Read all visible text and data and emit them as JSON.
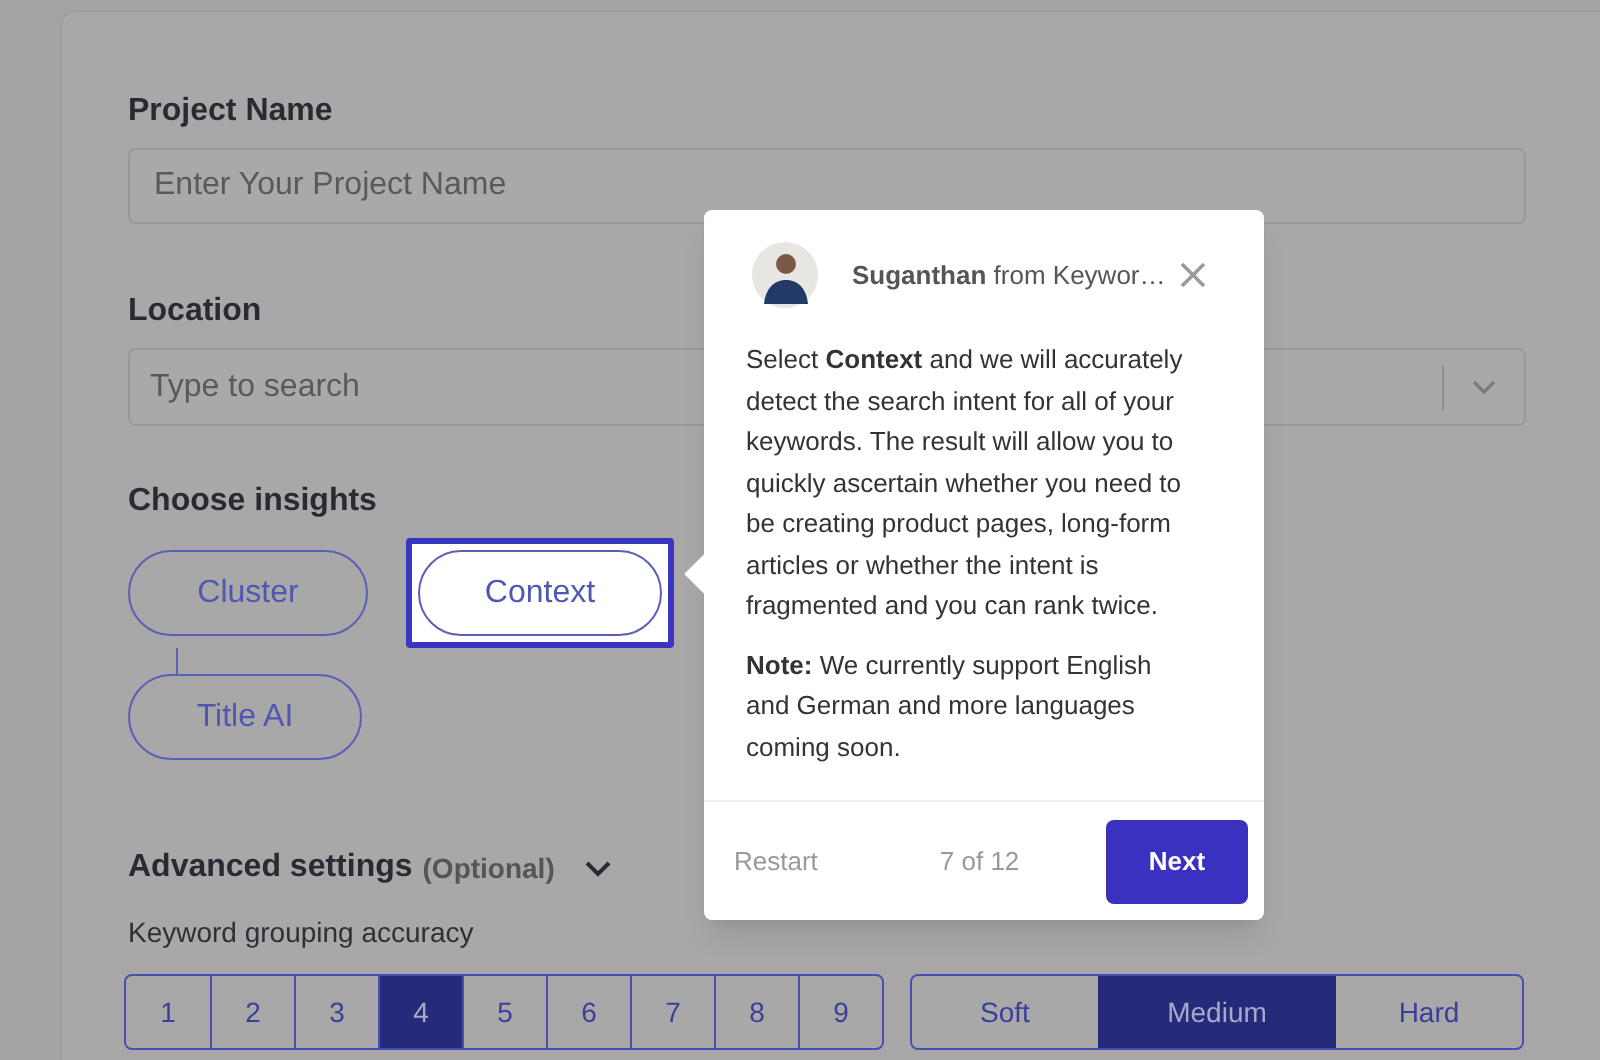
{
  "form": {
    "project_name": {
      "label": "Project Name",
      "placeholder": "Enter Your Project Name"
    },
    "location": {
      "label": "Location",
      "placeholder": "Type to search"
    },
    "insights": {
      "label": "Choose insights",
      "options": [
        {
          "label": "Cluster",
          "selected": false
        },
        {
          "label": "Context",
          "selected": true
        },
        {
          "label": "Title AI",
          "selected": false
        }
      ]
    },
    "advanced": {
      "title": "Advanced settings",
      "note": "(Optional)",
      "expanded": true,
      "accuracy": {
        "label": "Keyword grouping accuracy",
        "options": [
          {
            "label": "1",
            "selected": false
          },
          {
            "label": "2",
            "selected": false
          },
          {
            "label": "3",
            "selected": false
          },
          {
            "label": "4",
            "selected": true
          },
          {
            "label": "5",
            "selected": false
          },
          {
            "label": "6",
            "selected": false
          },
          {
            "label": "7",
            "selected": false
          },
          {
            "label": "8",
            "selected": false
          },
          {
            "label": "9",
            "selected": false
          }
        ]
      },
      "hub_method": {
        "options": [
          {
            "label": "Soft",
            "selected": false
          },
          {
            "label": "Medium",
            "selected": true
          },
          {
            "label": "Hard",
            "selected": false
          }
        ]
      }
    }
  },
  "tour_popover": {
    "sender": "Suganthan",
    "sender_org": "from Keywor…",
    "body": "Select **Context** and we will accurately detect the search intent for all of your keywords. The result will allow you to quickly ascertain whether you need to be creating product pages, long-form articles or whether the intent is fragmented and you can rank twice.",
    "note": "**Note:** We currently support English and German and more languages coming soon.",
    "restart": "Restart",
    "progress": "7 of 12",
    "next": "Next"
  }
}
